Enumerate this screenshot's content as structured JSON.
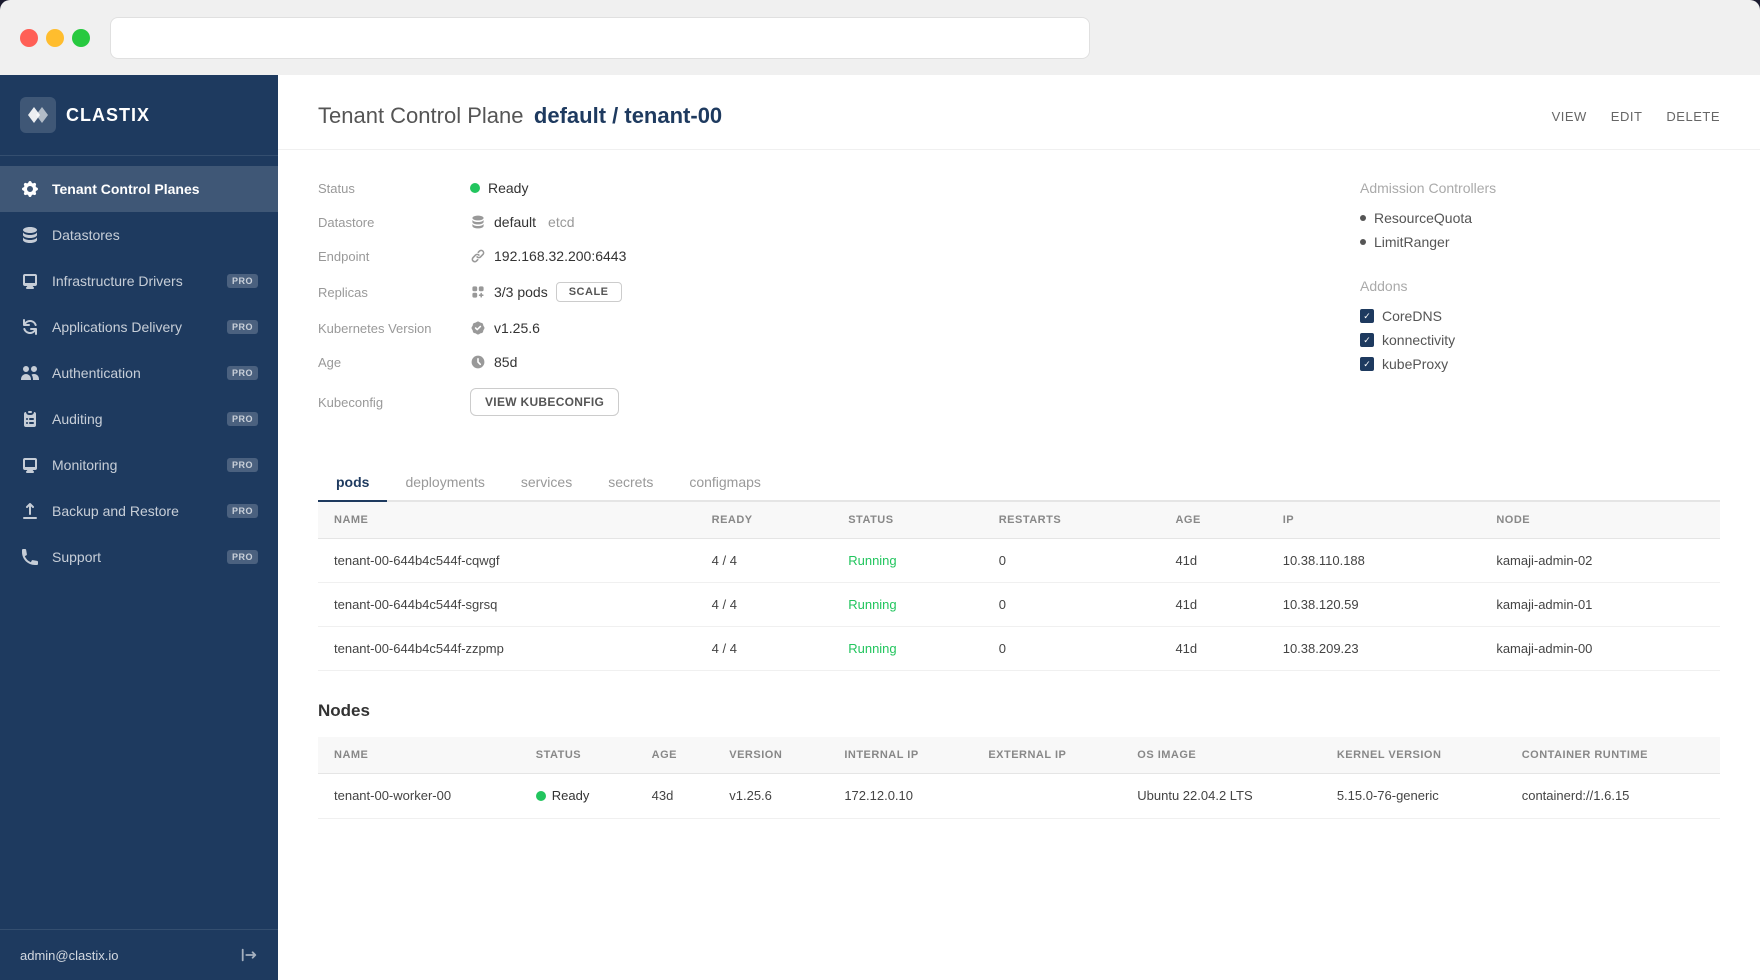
{
  "window": {
    "address_bar_placeholder": ""
  },
  "sidebar": {
    "logo_text": "CLASTIX",
    "nav_items": [
      {
        "id": "tenant-control-planes",
        "label": "Tenant Control Planes",
        "icon": "gear",
        "active": true,
        "pro": false
      },
      {
        "id": "datastores",
        "label": "Datastores",
        "icon": "database",
        "active": false,
        "pro": false
      },
      {
        "id": "infrastructure-drivers",
        "label": "Infrastructure Drivers",
        "icon": "monitor",
        "active": false,
        "pro": true
      },
      {
        "id": "applications-delivery",
        "label": "Applications Delivery",
        "icon": "refresh",
        "active": false,
        "pro": true
      },
      {
        "id": "authentication",
        "label": "Authentication",
        "icon": "users",
        "active": false,
        "pro": true
      },
      {
        "id": "auditing",
        "label": "Auditing",
        "icon": "clipboard",
        "active": false,
        "pro": true
      },
      {
        "id": "monitoring",
        "label": "Monitoring",
        "icon": "monitor2",
        "active": false,
        "pro": true
      },
      {
        "id": "backup-restore",
        "label": "Backup and Restore",
        "icon": "upload",
        "active": false,
        "pro": true
      },
      {
        "id": "support",
        "label": "Support",
        "icon": "phone",
        "active": false,
        "pro": true
      }
    ],
    "user_email": "admin@clastix.io",
    "pro_badge_label": "PRO"
  },
  "header": {
    "title_prefix": "Tenant Control Plane",
    "title_bold": "default / tenant-00",
    "actions": [
      "VIEW",
      "EDIT",
      "DELETE"
    ]
  },
  "detail": {
    "status_label": "Status",
    "status_value": "Ready",
    "datastore_label": "Datastore",
    "datastore_value": "default",
    "datastore_suffix": "etcd",
    "endpoint_label": "Endpoint",
    "endpoint_value": "192.168.32.200:6443",
    "replicas_label": "Replicas",
    "replicas_value": "3/3 pods",
    "replicas_btn": "SCALE",
    "k8s_version_label": "Kubernetes Version",
    "k8s_version_value": "v1.25.6",
    "age_label": "Age",
    "age_value": "85d",
    "kubeconfig_label": "Kubeconfig",
    "kubeconfig_btn": "VIEW KUBECONFIG"
  },
  "admission_controllers": {
    "title": "Admission Controllers",
    "items": [
      "ResourceQuota",
      "LimitRanger"
    ]
  },
  "addons": {
    "title": "Addons",
    "items": [
      {
        "label": "CoreDNS",
        "checked": true
      },
      {
        "label": "konnectivity",
        "checked": true
      },
      {
        "label": "kubeProxy",
        "checked": true
      }
    ]
  },
  "tabs": {
    "items": [
      {
        "id": "pods",
        "label": "pods",
        "active": true
      },
      {
        "id": "deployments",
        "label": "deployments",
        "active": false
      },
      {
        "id": "services",
        "label": "services",
        "active": false
      },
      {
        "id": "secrets",
        "label": "secrets",
        "active": false
      },
      {
        "id": "configmaps",
        "label": "configmaps",
        "active": false
      }
    ]
  },
  "pods_table": {
    "columns": [
      "NAME",
      "READY",
      "STATUS",
      "RESTARTS",
      "AGE",
      "IP",
      "NODE"
    ],
    "rows": [
      {
        "name": "tenant-00-644b4c544f-cqwgf",
        "ready": "4 / 4",
        "status": "Running",
        "restarts": "0",
        "age": "41d",
        "ip": "10.38.110.188",
        "node": "kamaji-admin-02"
      },
      {
        "name": "tenant-00-644b4c544f-sgrsq",
        "ready": "4 / 4",
        "status": "Running",
        "restarts": "0",
        "age": "41d",
        "ip": "10.38.120.59",
        "node": "kamaji-admin-01"
      },
      {
        "name": "tenant-00-644b4c544f-zzpmp",
        "ready": "4 / 4",
        "status": "Running",
        "restarts": "0",
        "age": "41d",
        "ip": "10.38.209.23",
        "node": "kamaji-admin-00"
      }
    ]
  },
  "nodes_section": {
    "title": "Nodes",
    "columns": [
      "NAME",
      "STATUS",
      "AGE",
      "VERSION",
      "INTERNAL IP",
      "EXTERNAL IP",
      "OS IMAGE",
      "KERNEL VERSION",
      "CONTAINER RUNTIME"
    ],
    "rows": [
      {
        "name": "tenant-00-worker-00",
        "status": "Ready",
        "age": "43d",
        "version": "v1.25.6",
        "internal_ip": "172.12.0.10",
        "external_ip": "",
        "os_image": "Ubuntu 22.04.2 LTS",
        "kernel_version": "5.15.0-76-generic",
        "container_runtime": "containerd://1.6.15"
      }
    ]
  }
}
